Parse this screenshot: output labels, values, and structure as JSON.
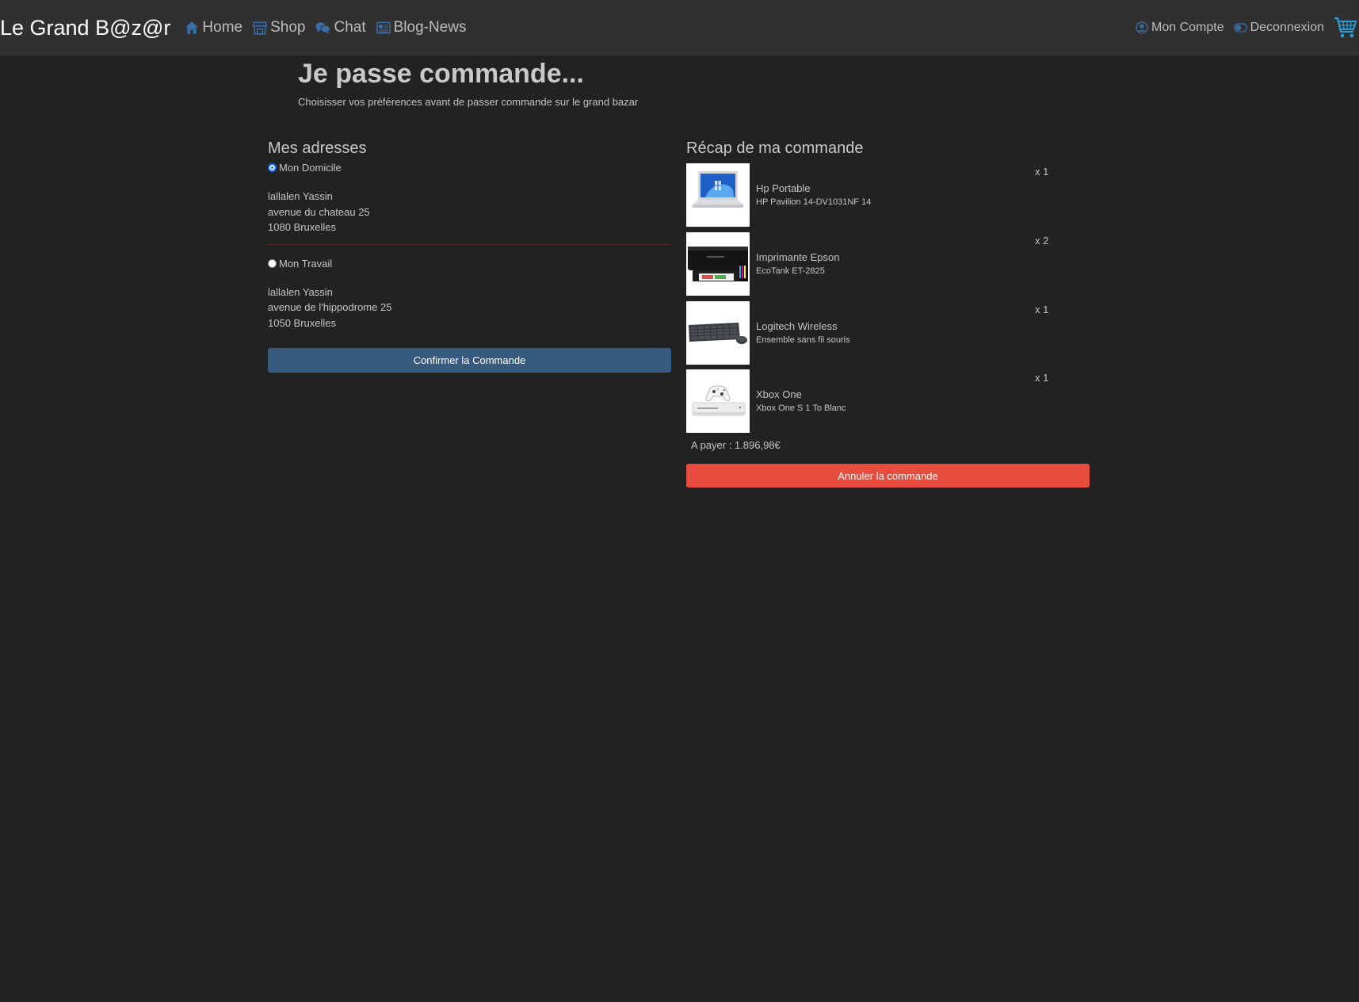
{
  "navbar": {
    "brand": "Le Grand B@z@r",
    "links": [
      {
        "label": "Home",
        "icon": "home-icon"
      },
      {
        "label": "Shop",
        "icon": "shop-icon"
      },
      {
        "label": "Chat",
        "icon": "chat-icon"
      },
      {
        "label": "Blog-News",
        "icon": "newspaper-icon"
      }
    ],
    "right_links": [
      {
        "label": "Mon Compte",
        "icon": "user-circle-icon"
      },
      {
        "label": "Deconnexion",
        "icon": "toggle-icon"
      }
    ],
    "cart_icon": "cart-icon"
  },
  "header": {
    "title": "Je passe commande...",
    "subtitle": "Choisisser vos préférences avant de passer commande sur le grand bazar"
  },
  "addresses": {
    "title": "Mes adresses",
    "items": [
      {
        "label": "Mon Domicile",
        "checked": true,
        "name": "lallalen Yassin",
        "street": "avenue du chateau 25",
        "city": "1080 Bruxelles"
      },
      {
        "label": "Mon Travail",
        "checked": false,
        "name": "lallalen Yassin",
        "street": "avenue de l'hippodrome 25",
        "city": "1050 Bruxelles"
      }
    ],
    "confirm_label": "Confirmer la Commande"
  },
  "recap": {
    "title": "Récap de ma commande",
    "items": [
      {
        "name": "Hp Portable",
        "desc": "HP Pavilion 14-DV1031NF 14",
        "qty": "x 1",
        "image": "laptop"
      },
      {
        "name": "Imprimante Epson",
        "desc": "EcoTank ET-2825",
        "qty": "x 2",
        "image": "printer"
      },
      {
        "name": "Logitech Wireless",
        "desc": "Ensemble sans fil souris",
        "qty": "x 1",
        "image": "keyboard"
      },
      {
        "name": "Xbox One",
        "desc": "Xbox One S 1 To Blanc",
        "qty": "x 1",
        "image": "console"
      }
    ],
    "total": "A payer : 1.896,98€",
    "cancel_label": "Annuler la commande"
  },
  "colors": {
    "background": "#222222",
    "navbar": "#303030",
    "primary": "#375a7f",
    "danger": "#e74c3c",
    "icon_blue": "#3a6ea8",
    "cart_blue": "#2a9fd6"
  }
}
